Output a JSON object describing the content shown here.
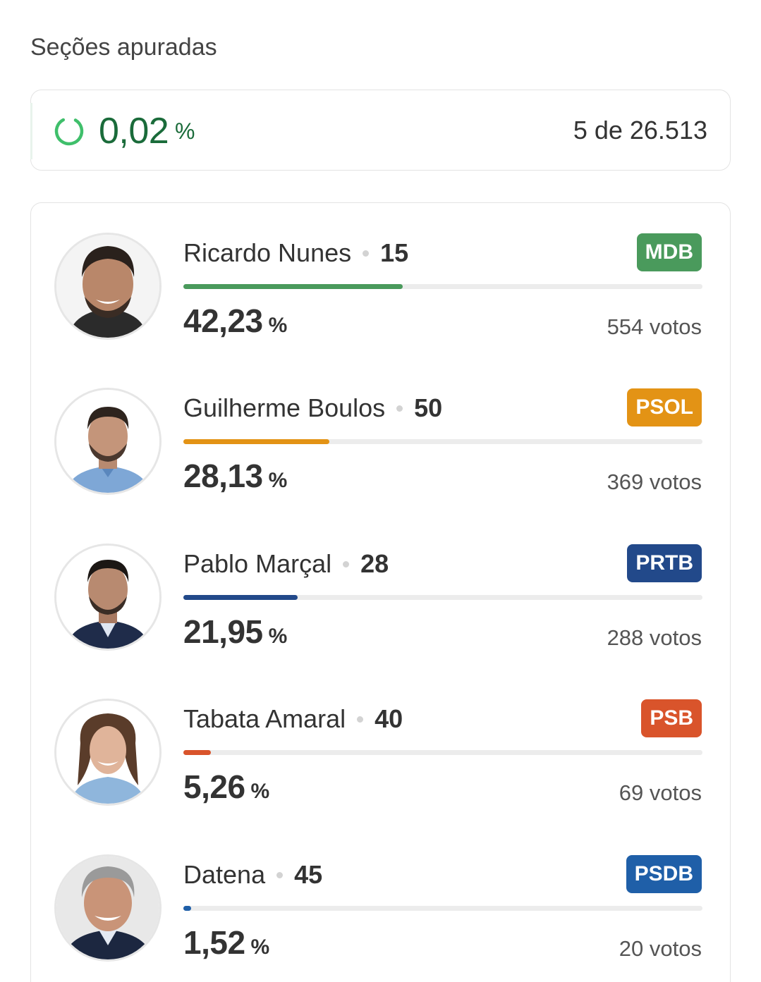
{
  "header": {
    "title": "Seções apuradas"
  },
  "progress": {
    "percent": "0,02",
    "percent_symbol": "%",
    "sections": "5 de 26.513",
    "ring_color": "#3fbf6b",
    "text_color": "#1a6b3a"
  },
  "candidates": [
    {
      "name": "Ricardo Nunes",
      "number": "15",
      "party": "MDB",
      "party_color": "#4a9a5c",
      "percent": "42,23",
      "percent_symbol": "%",
      "votes": "554 votos",
      "share": 0.4223
    },
    {
      "name": "Guilherme Boulos",
      "number": "50",
      "party": "PSOL",
      "party_color": "#e39315",
      "percent": "28,13",
      "percent_symbol": "%",
      "votes": "369 votos",
      "share": 0.2813
    },
    {
      "name": "Pablo Marçal",
      "number": "28",
      "party": "PRTB",
      "party_color": "#22498a",
      "percent": "21,95",
      "percent_symbol": "%",
      "votes": "288 votos",
      "share": 0.2195
    },
    {
      "name": "Tabata Amaral",
      "number": "40",
      "party": "PSB",
      "party_color": "#d9542b",
      "percent": "5,26",
      "percent_symbol": "%",
      "votes": "69 votos",
      "share": 0.0526
    },
    {
      "name": "Datena",
      "number": "45",
      "party": "PSDB",
      "party_color": "#1f5fa8",
      "percent": "1,52",
      "percent_symbol": "%",
      "votes": "20 votos",
      "share": 0.0152
    }
  ]
}
